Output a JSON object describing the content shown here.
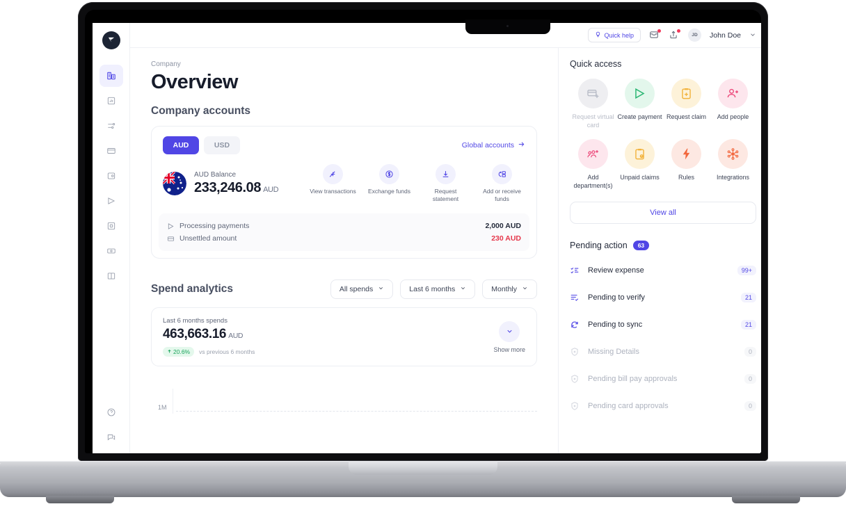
{
  "brand": {
    "accent": "#5046e5",
    "logo_icon": "vault-logo-icon"
  },
  "topbar": {
    "quick_help": "Quick help",
    "quick_help_icon": "lightbulb-icon",
    "icons": [
      {
        "name": "inbox-notification-icon",
        "has_dot": true
      },
      {
        "name": "share-notification-icon",
        "has_dot": true
      }
    ],
    "avatar_initials": "JD",
    "username": "John Doe",
    "caret_icon": "chevron-down-icon"
  },
  "sidebar": {
    "items": [
      {
        "name": "sidebar-item-company",
        "icon": "building-icon",
        "active": true
      },
      {
        "name": "sidebar-item-analytics",
        "icon": "chart-box-icon",
        "active": false
      },
      {
        "name": "sidebar-item-transactions",
        "icon": "sliders-icon",
        "active": false
      },
      {
        "name": "sidebar-item-cards",
        "icon": "card-icon",
        "active": false
      },
      {
        "name": "sidebar-item-wallet",
        "icon": "wallet-icon",
        "active": false
      },
      {
        "name": "sidebar-item-payments",
        "icon": "send-icon",
        "active": false
      },
      {
        "name": "sidebar-item-expenses",
        "icon": "receipt-icon",
        "active": false
      },
      {
        "name": "sidebar-item-accounts",
        "icon": "money-icon",
        "active": false
      },
      {
        "name": "sidebar-item-books",
        "icon": "book-icon",
        "active": false
      }
    ],
    "bottom_items": [
      {
        "name": "sidebar-item-help",
        "icon": "help-circle-icon"
      },
      {
        "name": "sidebar-item-chat",
        "icon": "chat-icon"
      }
    ]
  },
  "page": {
    "breadcrumb": "Company",
    "title": "Overview",
    "accounts_section_title": "Company accounts"
  },
  "account_card": {
    "currency_tabs": [
      {
        "label": "AUD",
        "selected": true
      },
      {
        "label": "USD",
        "selected": false
      }
    ],
    "global_link": "Global accounts",
    "global_link_icon": "arrow-right-icon",
    "flag_icon": "australia-flag-icon",
    "balance_label": "AUD Balance",
    "balance_amount": "233,246.08",
    "balance_currency": "AUD",
    "actions": [
      {
        "label": "View transactions",
        "icon": "transactions-arrows-icon"
      },
      {
        "label": "Exchange funds",
        "icon": "exchange-circle-icon"
      },
      {
        "label": "Request statement",
        "icon": "download-icon"
      },
      {
        "label": "Add or receive funds",
        "icon": "add-funds-icon"
      }
    ],
    "rows": [
      {
        "label": "Processing payments",
        "value": "2,000 AUD",
        "icon": "send-icon",
        "negative": false
      },
      {
        "label": "Unsettled amount",
        "value": "230 AUD",
        "icon": "card-icon",
        "negative": true
      }
    ]
  },
  "spend": {
    "section_title": "Spend analytics",
    "filters": [
      {
        "label": "All spends",
        "icon": "chevron-down-icon"
      },
      {
        "label": "Last 6 months",
        "icon": "chevron-down-icon"
      },
      {
        "label": "Monthly",
        "icon": "chevron-down-icon"
      }
    ],
    "summary_label": "Last 6 months spends",
    "summary_amount": "463,663.16",
    "summary_currency": "AUD",
    "delta": "20.6%",
    "delta_icon": "arrow-up-icon",
    "delta_note": "vs previous 6 months",
    "show_more": "Show more",
    "show_more_icon": "chevron-down-icon",
    "chart_data": {
      "type": "bar",
      "title": "Spend analytics",
      "categories": [],
      "values": [],
      "ylabel": "",
      "xlabel": "",
      "ytick_labels": [
        "1M"
      ],
      "grid": true,
      "legend": "none",
      "note": "chart cropped by viewport; only the 1M gridline is visible"
    }
  },
  "quick_access": {
    "title": "Quick access",
    "items": [
      {
        "label": "Request virtual card",
        "icon": "virtual-card-icon",
        "bg": "#eeeef1",
        "fg": "#b9bdc8",
        "disabled": true
      },
      {
        "label": "Create payment",
        "icon": "send-icon",
        "bg": "#e3f7ec",
        "fg": "#2bb673",
        "disabled": false
      },
      {
        "label": "Request claim",
        "icon": "clipboard-plus-icon",
        "bg": "#fdf2d9",
        "fg": "#f2b33d",
        "disabled": false
      },
      {
        "label": "Add people",
        "icon": "user-plus-icon",
        "bg": "#fde6ed",
        "fg": "#ec4a7b",
        "disabled": false
      },
      {
        "label": "Add department(s)",
        "icon": "department-icon",
        "bg": "#fde6ed",
        "fg": "#ec4a7b",
        "disabled": false
      },
      {
        "label": "Unpaid claims",
        "icon": "clipboard-alert-icon",
        "bg": "#fdf2d9",
        "fg": "#f2b33d",
        "disabled": false
      },
      {
        "label": "Rules",
        "icon": "bolt-icon",
        "bg": "#fde8e2",
        "fg": "#f2673d",
        "disabled": false
      },
      {
        "label": "Integrations",
        "icon": "integrations-icon",
        "bg": "#fde8e2",
        "fg": "#f2673d",
        "disabled": false
      }
    ],
    "view_all": "View all"
  },
  "pending_action": {
    "title": "Pending action",
    "count": "63",
    "items": [
      {
        "label": "Review expense",
        "badge": "99+",
        "icon": "checklist-icon",
        "dim": false
      },
      {
        "label": "Pending to verify",
        "badge": "21",
        "icon": "list-check-icon",
        "dim": false
      },
      {
        "label": "Pending to sync",
        "badge": "21",
        "icon": "sync-icon",
        "dim": false
      },
      {
        "label": "Missing Details",
        "badge": "0",
        "icon": "shield-icon",
        "dim": true
      },
      {
        "label": "Pending bill pay approvals",
        "badge": "0",
        "icon": "shield-icon",
        "dim": true
      },
      {
        "label": "Pending card approvals",
        "badge": "0",
        "icon": "shield-icon",
        "dim": true
      }
    ]
  }
}
